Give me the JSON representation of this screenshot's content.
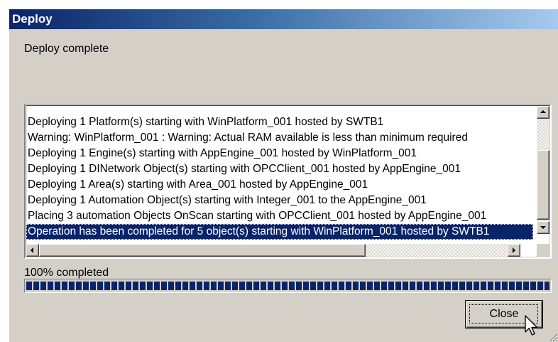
{
  "window": {
    "title": "Deploy"
  },
  "status": {
    "message": "Deploy complete"
  },
  "log": {
    "lines": [
      "Deploying 1 Platform(s) starting with WinPlatform_001 hosted by SWTB1",
      "Warning: WinPlatform_001 : Warning: Actual RAM available is less than minimum required",
      "Deploying 1 Engine(s) starting with AppEngine_001 hosted by WinPlatform_001",
      "Deploying 1 DINetwork Object(s) starting with OPCClient_001 hosted by AppEngine_001",
      "Deploying 1 Area(s) starting with Area_001 hosted by AppEngine_001",
      "Deploying 1 Automation Object(s) starting with Integer_001 to the AppEngine_001",
      "Placing 3 automation Objects OnScan starting with OPCClient_001 hosted by AppEngine_001",
      "Operation has been completed for 5 object(s) starting with WinPlatform_001 hosted by SWTB1"
    ],
    "selected_index": 7
  },
  "progress": {
    "label": "100% completed",
    "value": 1.0
  },
  "buttons": {
    "close_label": "Close"
  },
  "icons": {
    "scroll_up": "arrow-up-icon",
    "scroll_down": "arrow-down-icon",
    "scroll_left": "arrow-left-icon",
    "scroll_right": "arrow-right-icon",
    "cursor": "mouse-pointer-icon",
    "resize": "resize-grip-icon"
  },
  "colors": {
    "title_bar": "#0a246a",
    "selection": "#0a246a",
    "progress": "#0a246a",
    "face": "#d4d0c8"
  }
}
